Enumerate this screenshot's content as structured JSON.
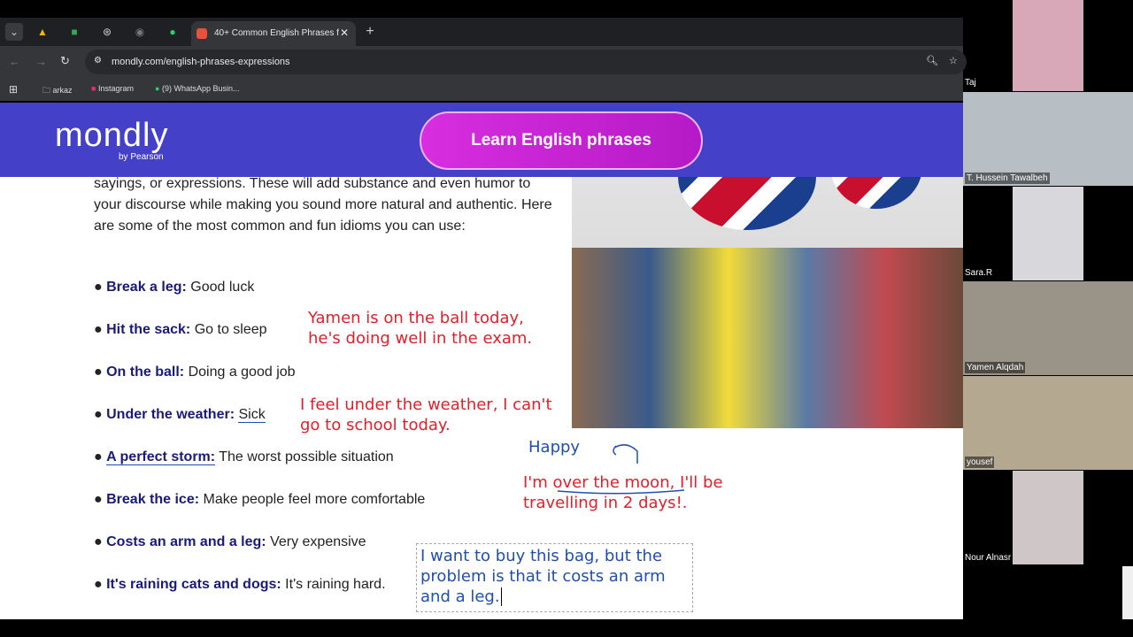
{
  "browser": {
    "active_tab": "40+ Common English Phrases f",
    "url": "mondly.com/english-phrases-expressions",
    "bookmarks": [
      "arkaz",
      "Instagram",
      "(9) WhatsApp Busin..."
    ]
  },
  "site": {
    "logo": "mondly",
    "logo_sub": "by Pearson",
    "cta": "Learn English phrases",
    "intro": "sayings, or expressions. These will add substance and even humor to your discourse while making you sound more natural and authentic. Here are some of the most common and fun idioms you can use:",
    "idioms": [
      {
        "term": "Break a leg:",
        "meaning": "Good luck"
      },
      {
        "term": "Hit the sack:",
        "meaning": "Go to sleep"
      },
      {
        "term": "On the ball:",
        "meaning": "Doing a good job"
      },
      {
        "term": "Under the weather:",
        "meaning": "Sick"
      },
      {
        "term": "A perfect storm:",
        "meaning": "The worst possible situation"
      },
      {
        "term": "Break the ice:",
        "meaning": "Make people feel more comfortable"
      },
      {
        "term": "Costs an arm and a leg:",
        "meaning": "Very expensive"
      },
      {
        "term": "It's raining cats and dogs:",
        "meaning": "It's raining hard."
      }
    ]
  },
  "annotations": {
    "ball1": "Yamen is on the ball today,",
    "ball2": "he's doing well in the exam.",
    "weather1": "I feel under the weather, I can't",
    "weather2": "go to school today.",
    "happy": "Happy",
    "moon1": "I'm over the moon, I'll be",
    "moon2": "travelling in 2 days!.",
    "note": "I want to buy this bag, but the problem is that it costs an arm and a leg."
  },
  "participants": [
    "Taj",
    "T. Hussein Tawalbeh",
    "Sara.R",
    "Yamen Alqdah",
    "yousef",
    "Nour Alnasr"
  ]
}
